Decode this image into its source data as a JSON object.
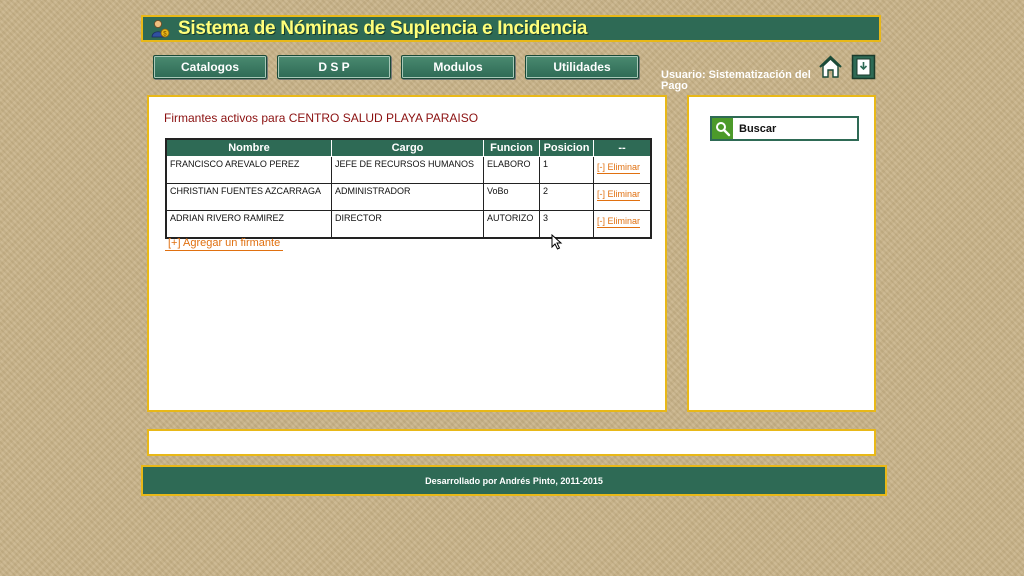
{
  "app": {
    "title": "Sistema de Nóminas de Suplencia e Incidencia"
  },
  "nav": {
    "items": [
      {
        "label": "Catalogos"
      },
      {
        "label": "D S P"
      },
      {
        "label": "Modulos"
      },
      {
        "label": "Utilidades"
      }
    ]
  },
  "user": {
    "label": "Usuario: Sistematización del Pago"
  },
  "icons": {
    "home": "home-icon",
    "logout": "exit-icon",
    "search": "search-icon",
    "logo": "user-money-icon"
  },
  "main": {
    "title": "Firmantes activos para CENTRO SALUD PLAYA PARAISO",
    "table": {
      "columns": [
        "Nombre",
        "Cargo",
        "Funcion",
        "Posicion",
        "--"
      ],
      "rows": [
        {
          "nombre": "FRANCISCO AREVALO PEREZ",
          "cargo": "JEFE DE RECURSOS HUMANOS",
          "funcion": "ELABORO",
          "posicion": "1",
          "action": "[-] Eliminar"
        },
        {
          "nombre": "CHRISTIAN FUENTES AZCARRAGA",
          "cargo": "ADMINISTRADOR",
          "funcion": "VoBo",
          "posicion": "2",
          "action": "[-] Eliminar"
        },
        {
          "nombre": "ADRIAN RIVERO RAMIREZ",
          "cargo": "DIRECTOR",
          "funcion": "AUTORIZO",
          "posicion": "3",
          "action": "[-] Eliminar"
        }
      ]
    },
    "add_label": "[+] Agregar un firmante"
  },
  "sidebar": {
    "search_label": "Buscar"
  },
  "footer": {
    "text": "Desarrollado por Andrés Pinto, 2011-2015"
  },
  "colors": {
    "header_bg": "#2e6a55",
    "border": "#e8b818",
    "title_text": "#ffff7a",
    "panel_title": "#8b1010",
    "link": "#e07010"
  }
}
